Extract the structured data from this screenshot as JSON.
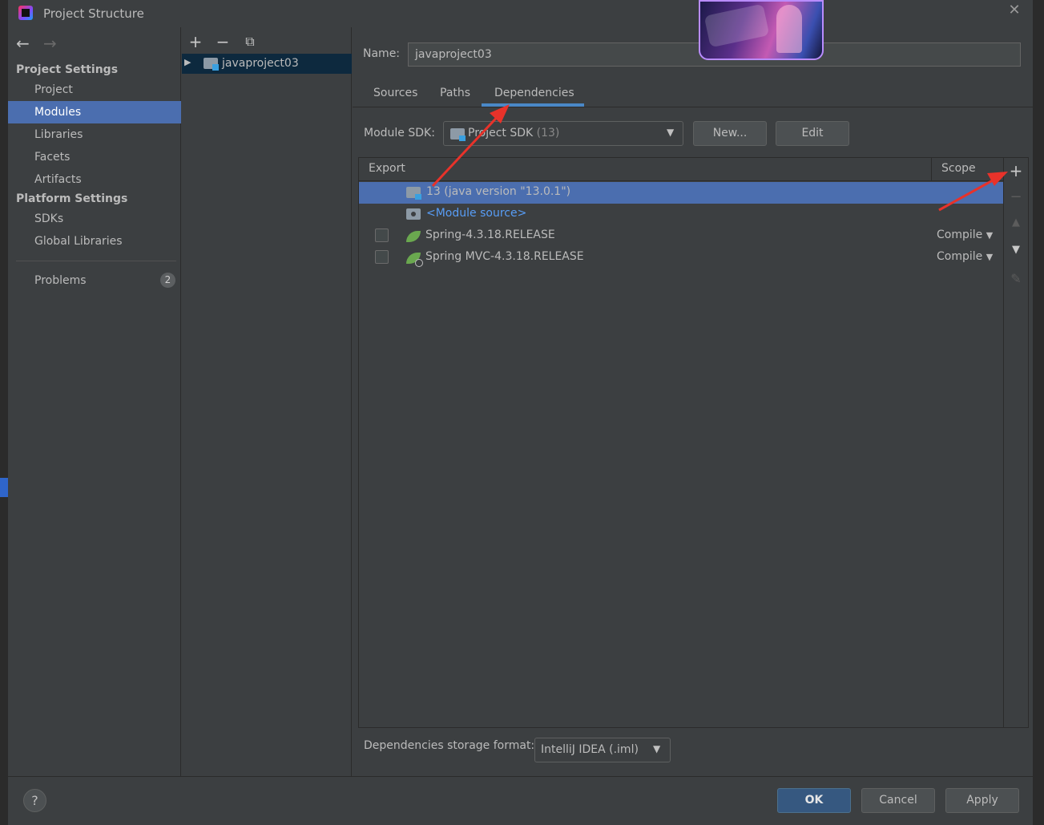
{
  "window": {
    "title": "Project Structure"
  },
  "nav": {
    "project_settings_header": "Project Settings",
    "platform_settings_header": "Platform Settings",
    "items": [
      {
        "label": "Project"
      },
      {
        "label": "Modules"
      },
      {
        "label": "Libraries"
      },
      {
        "label": "Facets"
      },
      {
        "label": "Artifacts"
      },
      {
        "label": "SDKs"
      },
      {
        "label": "Global Libraries"
      },
      {
        "label": "Problems"
      }
    ],
    "problems_count": "2",
    "selected": "Modules"
  },
  "tree": {
    "module_name": "javaproject03"
  },
  "module": {
    "name_label": "Name:",
    "name_value": "javaproject03",
    "tabs": [
      {
        "label": "Sources"
      },
      {
        "label": "Paths"
      },
      {
        "label": "Dependencies"
      }
    ],
    "active_tab": "Dependencies",
    "sdk_label": "Module SDK:",
    "sdk_value": "Project SDK",
    "sdk_version": "(13)",
    "new_button": "New...",
    "edit_button": "Edit"
  },
  "dependencies": {
    "columns": {
      "export": "Export",
      "scope": "Scope"
    },
    "rows": [
      {
        "label": "13 (java version \"13.0.1\")",
        "scope": "",
        "selected": true
      },
      {
        "label": "<Module source>",
        "scope": ""
      },
      {
        "label": "Spring-4.3.18.RELEASE",
        "scope": "Compile"
      },
      {
        "label": "Spring MVC-4.3.18.RELEASE",
        "scope": "Compile"
      }
    ]
  },
  "storage": {
    "label": "Dependencies storage format:",
    "value": "IntelliJ IDEA (.iml)"
  },
  "footer": {
    "help": "?",
    "ok": "OK",
    "cancel": "Cancel",
    "apply": "Apply"
  },
  "colors": {
    "selection": "#4b6eaf",
    "accent_tab": "#4a88c7",
    "annotation_arrow": "#e8322a",
    "link": "#589df6"
  }
}
